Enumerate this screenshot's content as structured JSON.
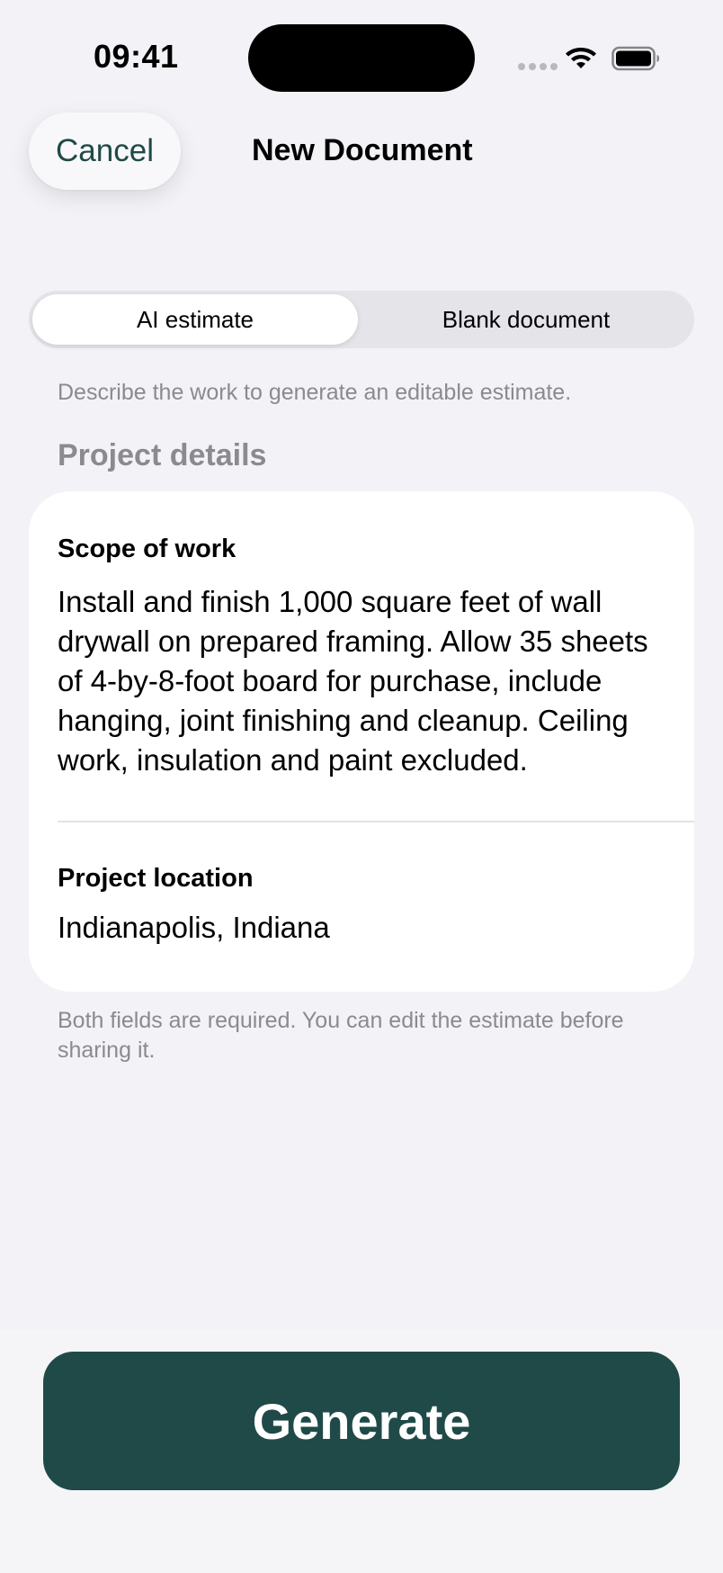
{
  "status_bar": {
    "time": "09:41",
    "icons": [
      "cellular-dots-icon",
      "wifi-icon",
      "battery-icon"
    ]
  },
  "nav": {
    "cancel_label": "Cancel",
    "title": "New Document"
  },
  "segmented_control": {
    "options": [
      "AI estimate",
      "Blank document"
    ],
    "selected": "AI estimate"
  },
  "helper_text": "Describe the work to generate an editable estimate.",
  "section_title": "Project details",
  "form": {
    "scope": {
      "label": "Scope of work",
      "value": "Install and finish 1,000 square feet of wall drywall on prepared framing. Allow 35 sheets of 4-by-8-foot board for purchase, include hanging, joint finishing and cleanup. Ceiling work, insulation and paint excluded."
    },
    "location": {
      "label": "Project location",
      "value": "Indianapolis, Indiana"
    }
  },
  "footer_note": "Both fields are required. You can edit the estimate before sharing it.",
  "generate_label": "Generate",
  "colors": {
    "accent": "#1f4a48",
    "background": "#f2f2f7",
    "secondary_text": "#8a8a8f"
  }
}
